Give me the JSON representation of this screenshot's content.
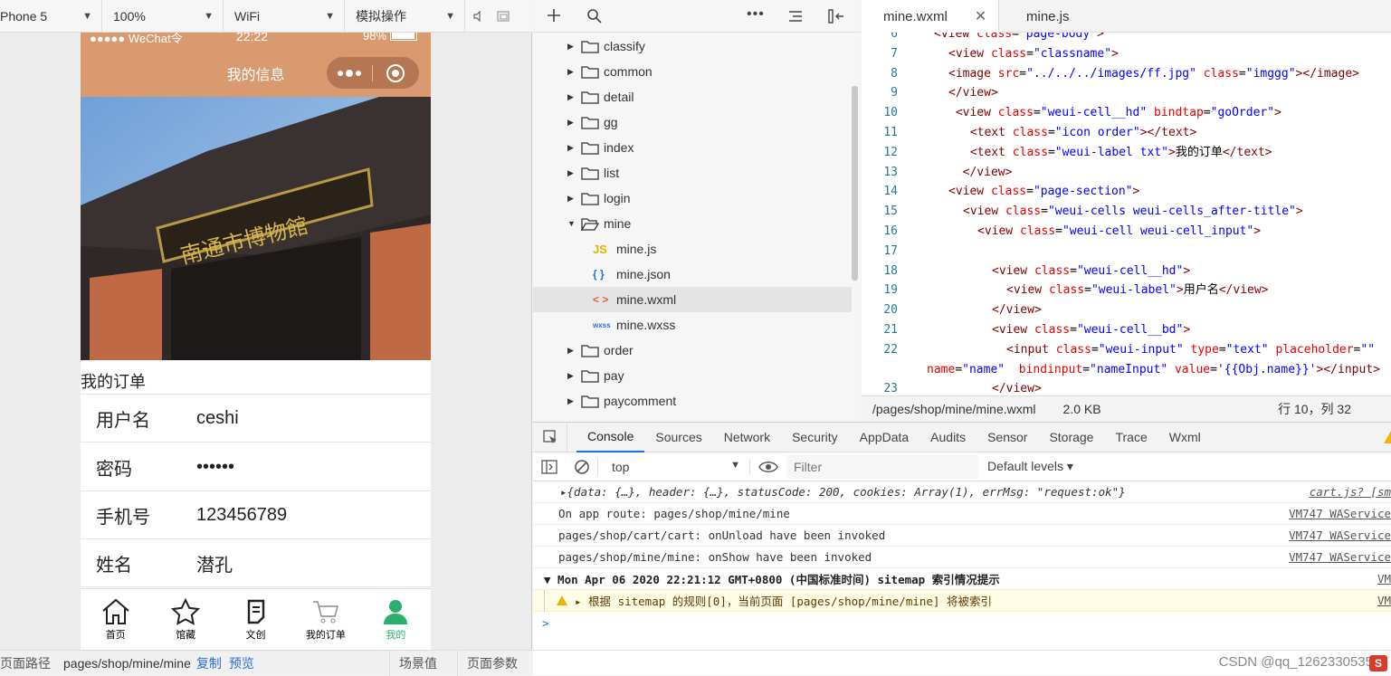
{
  "toolbar": {
    "device": "Phone 5",
    "zoom": "100%",
    "network": "WiFi",
    "operation": "模拟操作"
  },
  "phone": {
    "status_left": "●●●●● WeChat令",
    "time": "22:22",
    "battery": "98%",
    "title": "我的信息",
    "sign_text": "南通市博物館",
    "orders_label": "我的订单",
    "form": [
      {
        "label": "用户名",
        "value": "ceshi"
      },
      {
        "label": "密码",
        "value": "••••••"
      },
      {
        "label": "手机号",
        "value": "123456789"
      },
      {
        "label": "姓名",
        "value": "潜孔"
      }
    ],
    "tabs": [
      {
        "label": "首页",
        "icon": "home-icon"
      },
      {
        "label": "馆藏",
        "icon": "star-icon"
      },
      {
        "label": "文创",
        "icon": "notebook-icon"
      },
      {
        "label": "我的订单",
        "icon": "cart-icon"
      },
      {
        "label": "我的",
        "icon": "user-icon"
      }
    ]
  },
  "sim_status": {
    "path_label": "页面路径",
    "path": "pages/shop/mine/mine",
    "copy": "复制",
    "preview": "预览",
    "scene": "场景值",
    "params": "页面参数"
  },
  "tree": [
    {
      "name": "classify",
      "kind": "folder"
    },
    {
      "name": "common",
      "kind": "folder"
    },
    {
      "name": "detail",
      "kind": "folder"
    },
    {
      "name": "gg",
      "kind": "folder"
    },
    {
      "name": "index",
      "kind": "folder"
    },
    {
      "name": "list",
      "kind": "folder"
    },
    {
      "name": "login",
      "kind": "folder"
    },
    {
      "name": "mine",
      "kind": "open-folder"
    },
    {
      "name": "mine.js",
      "kind": "js",
      "badge": "JS"
    },
    {
      "name": "mine.json",
      "kind": "json",
      "badge": "{ }"
    },
    {
      "name": "mine.wxml",
      "kind": "wxml",
      "badge": "< >"
    },
    {
      "name": "mine.wxss",
      "kind": "wxss",
      "badge": "wxss"
    },
    {
      "name": "order",
      "kind": "folder"
    },
    {
      "name": "pay",
      "kind": "folder"
    },
    {
      "name": "paycomment",
      "kind": "folder"
    }
  ],
  "editor": {
    "tabs": [
      "mine.wxml",
      "mine.js"
    ],
    "lines": [
      {
        "n": "6",
        "indent": 1,
        "parts": [
          [
            "tg",
            "<view "
          ],
          [
            "at",
            "class"
          ],
          [
            "tx",
            "="
          ],
          [
            "st",
            "\"page-body\""
          ],
          [
            "tg",
            ">"
          ]
        ]
      },
      {
        "n": "7",
        "indent": 2,
        "parts": [
          [
            "tg",
            "<view "
          ],
          [
            "at",
            "class"
          ],
          [
            "tx",
            "="
          ],
          [
            "st",
            "\"classname\""
          ],
          [
            "tg",
            ">"
          ]
        ]
      },
      {
        "n": "8",
        "indent": 2,
        "parts": [
          [
            "tg",
            "<image "
          ],
          [
            "at",
            "src"
          ],
          [
            "tx",
            "="
          ],
          [
            "st",
            "\"../../../images/ff.jpg\""
          ],
          [
            "tx",
            " "
          ],
          [
            "at",
            "class"
          ],
          [
            "tx",
            "="
          ],
          [
            "st",
            "\"imggg\""
          ],
          [
            "tg",
            "></image>"
          ]
        ]
      },
      {
        "n": "9",
        "indent": 2,
        "parts": [
          [
            "tg",
            "</view>"
          ]
        ]
      },
      {
        "n": "10",
        "indent": 2,
        "parts": [
          [
            "tg",
            " <view "
          ],
          [
            "at",
            "class"
          ],
          [
            "tx",
            "="
          ],
          [
            "st",
            "\"weui-cell__hd\""
          ],
          [
            "tx",
            " "
          ],
          [
            "at",
            "bindtap"
          ],
          [
            "tx",
            "="
          ],
          [
            "st",
            "\"goOrder\""
          ],
          [
            "tg",
            ">"
          ]
        ]
      },
      {
        "n": "11",
        "indent": 3,
        "parts": [
          [
            "tg",
            " <text "
          ],
          [
            "at",
            "class"
          ],
          [
            "tx",
            "="
          ],
          [
            "st",
            "\"icon order\""
          ],
          [
            "tg",
            "></text>"
          ]
        ]
      },
      {
        "n": "12",
        "indent": 3,
        "parts": [
          [
            "tg",
            " <text "
          ],
          [
            "at",
            "class"
          ],
          [
            "tx",
            "="
          ],
          [
            "st",
            "\"weui-label txt\""
          ],
          [
            "tg",
            ">"
          ],
          [
            "tx",
            "我的订单"
          ],
          [
            "tg",
            "</text>"
          ]
        ]
      },
      {
        "n": "13",
        "indent": 2,
        "parts": [
          [
            "tg",
            "  </view>"
          ]
        ]
      },
      {
        "n": "14",
        "indent": 2,
        "parts": [
          [
            "tg",
            "<view "
          ],
          [
            "at",
            "class"
          ],
          [
            "tx",
            "="
          ],
          [
            "st",
            "\"page-section\""
          ],
          [
            "tg",
            ">"
          ]
        ]
      },
      {
        "n": "15",
        "indent": 3,
        "parts": [
          [
            "tg",
            "<view "
          ],
          [
            "at",
            "class"
          ],
          [
            "tx",
            "="
          ],
          [
            "st",
            "\"weui-cells weui-cells_after-title\""
          ],
          [
            "tg",
            ">"
          ]
        ]
      },
      {
        "n": "16",
        "indent": 4,
        "parts": [
          [
            "tg",
            "<view "
          ],
          [
            "at",
            "class"
          ],
          [
            "tx",
            "="
          ],
          [
            "st",
            "\"weui-cell weui-cell_input\""
          ],
          [
            "tg",
            ">"
          ]
        ]
      },
      {
        "n": "17",
        "indent": 0,
        "parts": []
      },
      {
        "n": "18",
        "indent": 5,
        "parts": [
          [
            "tg",
            "<view "
          ],
          [
            "at",
            "class"
          ],
          [
            "tx",
            "="
          ],
          [
            "st",
            "\"weui-cell__hd\""
          ],
          [
            "tg",
            ">"
          ]
        ]
      },
      {
        "n": "19",
        "indent": 6,
        "parts": [
          [
            "tg",
            "<view "
          ],
          [
            "at",
            "class"
          ],
          [
            "tx",
            "="
          ],
          [
            "st",
            "\"weui-label\""
          ],
          [
            "tg",
            ">"
          ],
          [
            "tx",
            "用户名"
          ],
          [
            "tg",
            "</view>"
          ]
        ]
      },
      {
        "n": "20",
        "indent": 5,
        "parts": [
          [
            "tg",
            "</view>"
          ]
        ]
      },
      {
        "n": "21",
        "indent": 5,
        "parts": [
          [
            "tg",
            "<view "
          ],
          [
            "at",
            "class"
          ],
          [
            "tx",
            "="
          ],
          [
            "st",
            "\"weui-cell__bd\""
          ],
          [
            "tg",
            ">"
          ]
        ]
      },
      {
        "n": "22",
        "indent": 6,
        "parts": [
          [
            "tg",
            "<input "
          ],
          [
            "at",
            "class"
          ],
          [
            "tx",
            "="
          ],
          [
            "st",
            "\"weui-input\""
          ],
          [
            "tx",
            " "
          ],
          [
            "at",
            "type"
          ],
          [
            "tx",
            "="
          ],
          [
            "st",
            "\"text\""
          ],
          [
            "tx",
            " "
          ],
          [
            "at",
            "placeholder"
          ],
          [
            "tx",
            "="
          ],
          [
            "st",
            "\"\""
          ]
        ]
      },
      {
        "n": "",
        "indent": -1,
        "parts": [
          [
            "at",
            "name"
          ],
          [
            "tx",
            "="
          ],
          [
            "st",
            "\"name\""
          ],
          [
            "tx",
            "  "
          ],
          [
            "at",
            "bindinput"
          ],
          [
            "tx",
            "="
          ],
          [
            "st",
            "\"nameInput\""
          ],
          [
            "tx",
            " "
          ],
          [
            "at",
            "value"
          ],
          [
            "tx",
            "="
          ],
          [
            "st",
            "'{{Obj.name}}'"
          ],
          [
            "tg",
            "></input>"
          ]
        ]
      },
      {
        "n": "23",
        "indent": 5,
        "parts": [
          [
            "tg",
            "</view>"
          ]
        ]
      }
    ],
    "status_path": "/pages/shop/mine/mine.wxml",
    "status_size": "2.0 KB",
    "status_pos": "行 10，列 32"
  },
  "devtools": {
    "tabs": [
      "Console",
      "Sources",
      "Network",
      "Security",
      "AppData",
      "Audits",
      "Sensor",
      "Storage",
      "Trace",
      "Wxml"
    ],
    "context": "top",
    "filter_placeholder": "Filter",
    "levels": "Default levels ▾",
    "logs": [
      {
        "text": "▸{data: {…}, header: {…}, statusCode: 200, cookies: Array(1), errMsg: \"request:ok\"}",
        "src": "cart.js? [sm",
        "kind": "obj"
      },
      {
        "text": "On app route: pages/shop/mine/mine",
        "src": "VM747 WAService",
        "kind": "log"
      },
      {
        "text": "pages/shop/cart/cart: onUnload have been invoked",
        "src": "VM747 WAService",
        "kind": "log"
      },
      {
        "text": "pages/shop/mine/mine: onShow have been invoked",
        "src": "VM747 WAService",
        "kind": "log"
      },
      {
        "text": "▼ Mon Apr 06 2020 22:21:12 GMT+0800 (中国标准时间) sitemap 索引情况提示",
        "src": "VM",
        "kind": "group"
      },
      {
        "text": "▸ 根据 sitemap 的规则[0]，当前页面 [pages/shop/mine/mine] 将被索引",
        "src": "VM",
        "kind": "warn"
      }
    ],
    "prompt": ">"
  },
  "watermark": "CSDN @qq_1262330535"
}
